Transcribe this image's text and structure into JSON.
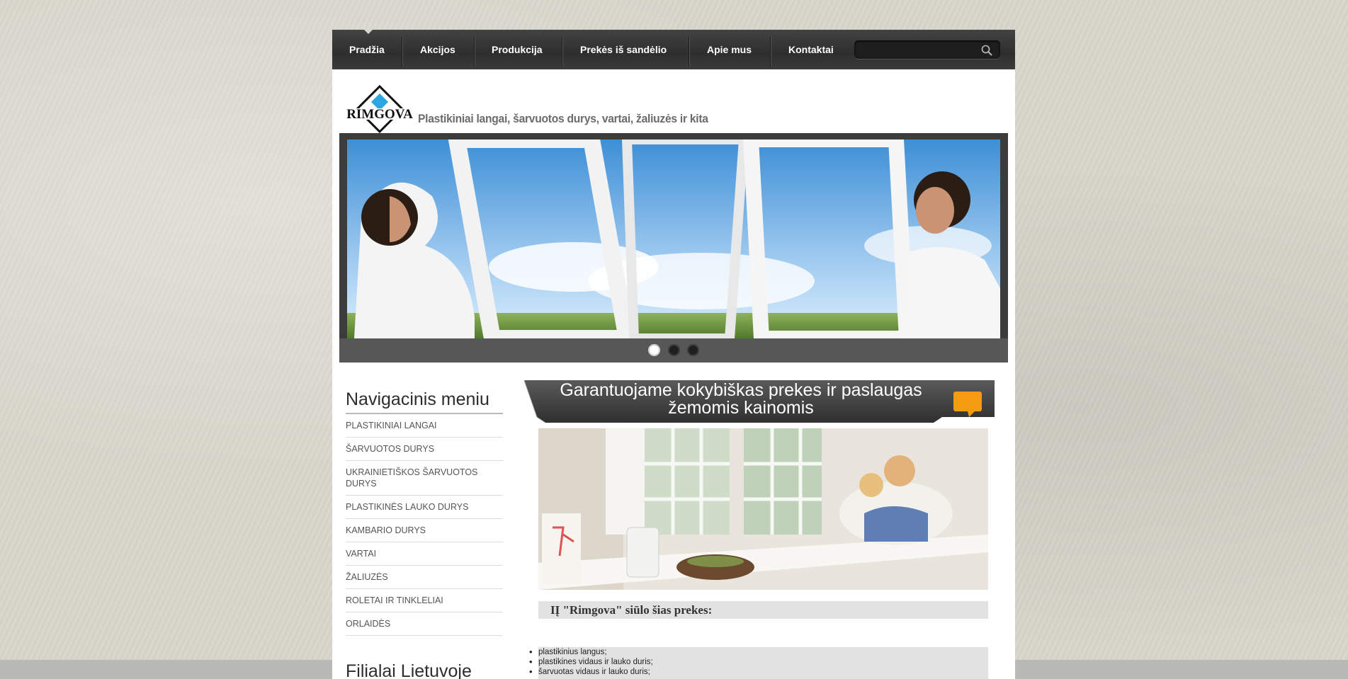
{
  "nav": {
    "items": [
      {
        "label": "Pradžia",
        "active": true
      },
      {
        "label": "Akcijos"
      },
      {
        "label": "Produkcija"
      },
      {
        "label": "Prekės iš sandėlio"
      },
      {
        "label": "Apie mus"
      },
      {
        "label": "Kontaktai"
      }
    ],
    "search_value": "",
    "search_icon": "magnifier-icon"
  },
  "header": {
    "logo_text": "RIMGOVA",
    "tagline": "Plastikiniai langai, šarvuotos durys, vartai, žaliuzės ir kita"
  },
  "slider": {
    "slide_count": 3,
    "active_slide": 1
  },
  "sidebar": {
    "title": "Navigacinis meniu",
    "items": [
      "PLASTIKINIAI LANGAI",
      "ŠARVUOTOS DURYS",
      "UKRAINIETIŠKOS ŠARVUOTOS DURYS",
      "PLASTIKINĖS LAUKO DURYS",
      "KAMBARIO DURYS",
      "VARTAI",
      "ŽALIUZĖS",
      "ROLETAI IR TINKLELIAI",
      "ORLAIDĖS"
    ],
    "branches_title": "Filialai Lietuvoje"
  },
  "main": {
    "banner_title": "Garantuojame kokybiškas prekes ir paslaugas žemomis kainomis",
    "intro": "IĮ \"Rimgova\" siūlo šias prekes:",
    "products": [
      "plastikinius langus;",
      "plastikines vidaus ir lauko duris;",
      "šarvuotas vidaus ir lauko duris;"
    ]
  },
  "colors": {
    "nav_bg": "#333333",
    "logo_blue": "#2aa7e0",
    "accent_orange": "#f39c12",
    "background": "#d9d6cc"
  }
}
